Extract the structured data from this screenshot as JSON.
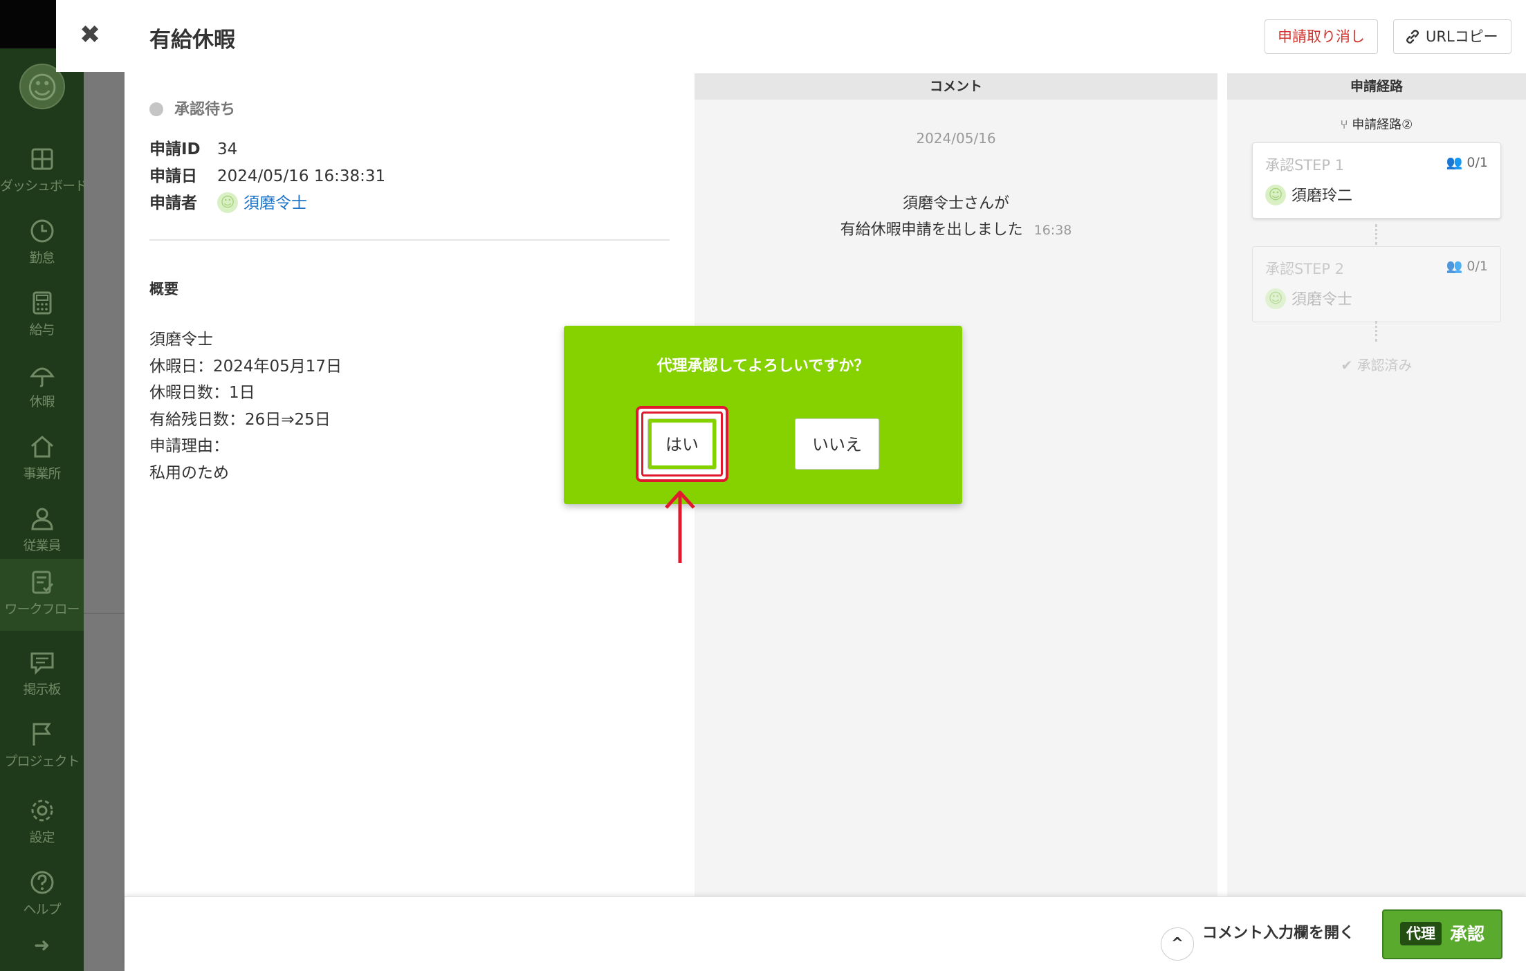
{
  "sidebar": {
    "items": [
      {
        "label": "ダッシュボード",
        "icon": "dashboard-icon"
      },
      {
        "label": "勤怠",
        "icon": "clock-icon"
      },
      {
        "label": "給与",
        "icon": "calculator-icon"
      },
      {
        "label": "休暇",
        "icon": "umbrella-icon"
      },
      {
        "label": "事業所",
        "icon": "home-icon"
      },
      {
        "label": "従業員",
        "icon": "person-icon"
      },
      {
        "label": "ワークフロー",
        "icon": "checklist-icon"
      },
      {
        "label": "掲示板",
        "icon": "message-board-icon"
      },
      {
        "label": "プロジェクト",
        "icon": "flag-icon"
      },
      {
        "label": "設定",
        "icon": "gear-icon"
      },
      {
        "label": "ヘルプ",
        "icon": "help-icon"
      }
    ],
    "collapse_glyph": "➜"
  },
  "header": {
    "close_glyph": "✖",
    "title": "有給休暇",
    "cancel_label": "申請取り消し",
    "url_copy_label": "URLコピー"
  },
  "detail": {
    "status": "承認待ち",
    "rows": [
      {
        "key": "申請ID",
        "value": "34"
      },
      {
        "key": "申請日",
        "value": "2024/05/16 16:38:31"
      },
      {
        "key": "申請者",
        "value": "須磨令士"
      }
    ],
    "summary_heading": "概要",
    "summary_text": "須磨令士\n休暇日：2024年05月17日\n休暇日数：1日\n有給残日数：26日⇒25日\n申請理由：\n私用のため"
  },
  "comments": {
    "heading": "コメント",
    "date": "2024/05/16",
    "message_line1": "須磨令士さんが",
    "message_line2": "有給休暇申請を出しました",
    "time": "16:38"
  },
  "route": {
    "heading": "申請経路",
    "name": "申請経路②",
    "steps": [
      {
        "title": "承認STEP 1",
        "count": "0/1",
        "approver": "須磨玲二"
      },
      {
        "title": "承認STEP 2",
        "count": "0/1",
        "approver": "須磨令士"
      }
    ],
    "done_label": "承認済み"
  },
  "footer": {
    "open_comment_label": "コメント入力欄を開く",
    "approve_badge": "代理",
    "approve_label": "承認"
  },
  "modal": {
    "question": "代理承認してよろしいですか？",
    "yes_label": "はい",
    "no_label": "いいえ"
  },
  "colors": {
    "accent_green": "#86d200",
    "approve_green": "#5aaa2e",
    "highlight_red": "#e0192e",
    "link_blue": "#1f74c8",
    "sidebar_dark": "#1f3a1a"
  }
}
